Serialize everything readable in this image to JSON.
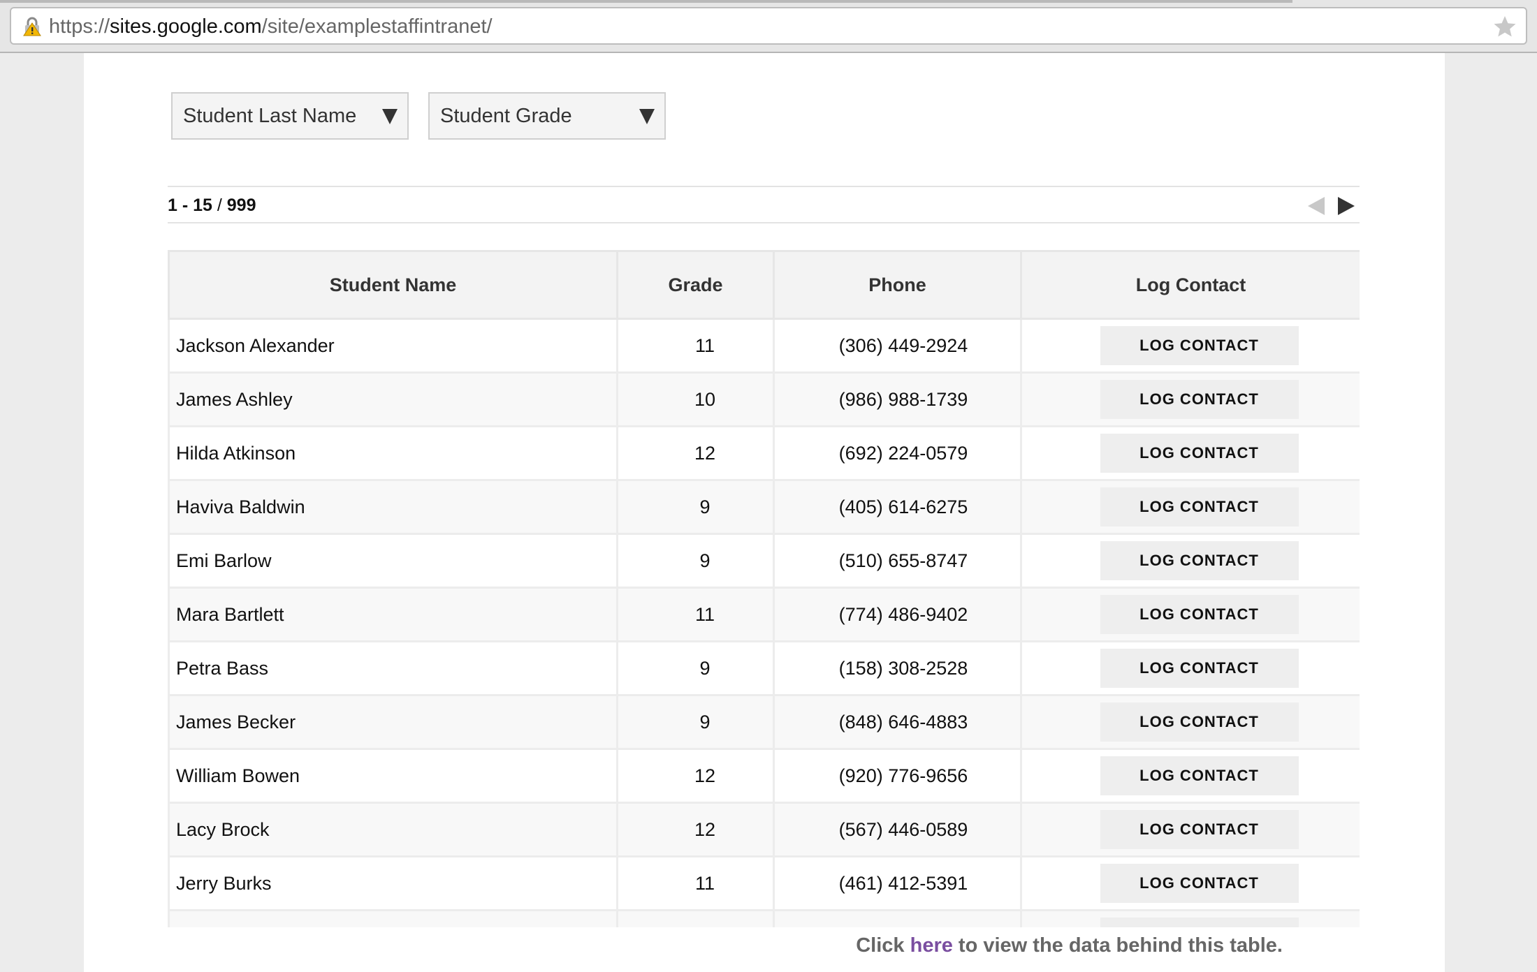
{
  "browser": {
    "url_prefix": "https://",
    "url_domain": "sites.google.com",
    "url_path": "/site/examplestaffintranet/"
  },
  "filters": {
    "last_name_label": "Student Last Name",
    "grade_label": "Student Grade"
  },
  "pagination": {
    "range": "1 - 15",
    "separator": " / ",
    "total": "999"
  },
  "table": {
    "columns": [
      "Student Name",
      "Grade",
      "Phone",
      "Log Contact"
    ],
    "button_label": "LOG CONTACT",
    "rows": [
      {
        "name": "Jackson Alexander",
        "grade": "11",
        "phone": "(306) 449-2924"
      },
      {
        "name": "James Ashley",
        "grade": "10",
        "phone": "(986) 988-1739"
      },
      {
        "name": "Hilda Atkinson",
        "grade": "12",
        "phone": "(692) 224-0579"
      },
      {
        "name": "Haviva Baldwin",
        "grade": "9",
        "phone": "(405) 614-6275"
      },
      {
        "name": "Emi Barlow",
        "grade": "9",
        "phone": "(510) 655-8747"
      },
      {
        "name": "Mara Bartlett",
        "grade": "11",
        "phone": "(774) 486-9402"
      },
      {
        "name": "Petra Bass",
        "grade": "9",
        "phone": "(158) 308-2528"
      },
      {
        "name": "James Becker",
        "grade": "9",
        "phone": "(848) 646-4883"
      },
      {
        "name": "William Bowen",
        "grade": "12",
        "phone": "(920) 776-9656"
      },
      {
        "name": "Lacy Brock",
        "grade": "12",
        "phone": "(567) 446-0589"
      },
      {
        "name": "Jerry Burks",
        "grade": "11",
        "phone": "(461) 412-5391"
      }
    ]
  },
  "footer": {
    "before": "Click ",
    "link": "here",
    "after": " to view the data behind this table."
  },
  "icons": {
    "lock": "lock-warning-icon",
    "star": "star-icon",
    "caret": "triangle-down-icon",
    "prev": "triangle-left-icon",
    "next": "triangle-right-icon"
  },
  "colors": {
    "link": "#7a4ea0",
    "header_bg": "#f3f3f3",
    "button_bg": "#eeeeee",
    "lock": "#f2b705"
  }
}
